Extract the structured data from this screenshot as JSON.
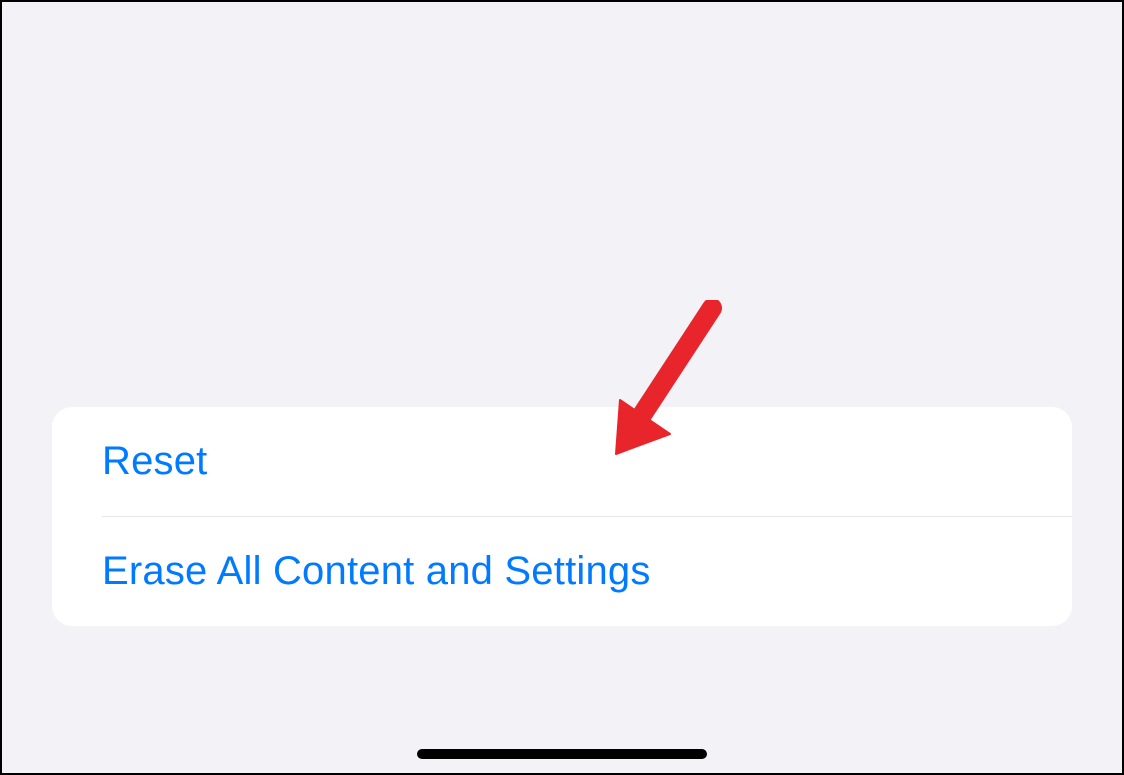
{
  "settings": {
    "rows": [
      {
        "label": "Reset"
      },
      {
        "label": "Erase All Content and Settings"
      }
    ]
  },
  "colors": {
    "link": "#007aff",
    "background": "#f2f2f7",
    "card": "#ffffff",
    "divider": "#e5e5ea",
    "arrow": "#e8252a"
  }
}
